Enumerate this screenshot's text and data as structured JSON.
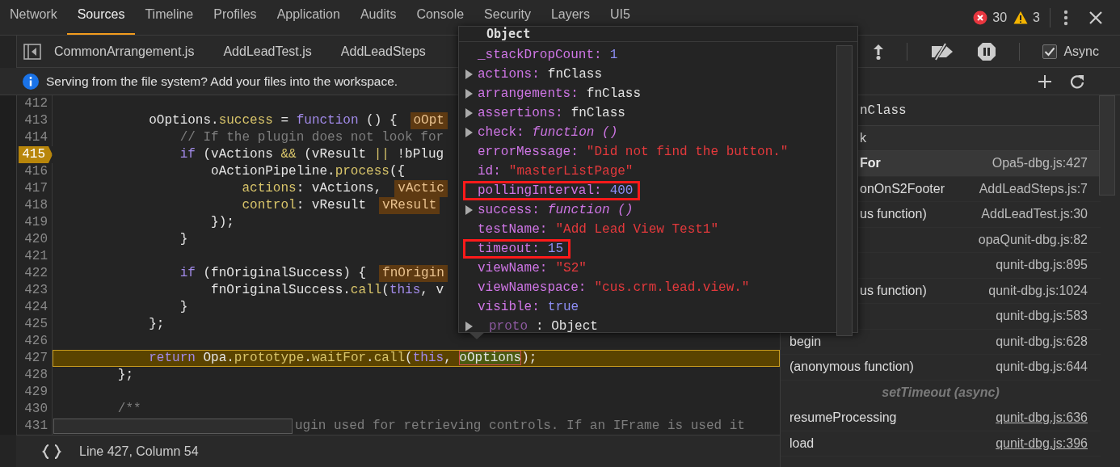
{
  "main_tabs": [
    {
      "label": "Network",
      "selected": false
    },
    {
      "label": "Sources",
      "selected": true
    },
    {
      "label": "Timeline",
      "selected": false
    },
    {
      "label": "Profiles",
      "selected": false
    },
    {
      "label": "Application",
      "selected": false
    },
    {
      "label": "Audits",
      "selected": false
    },
    {
      "label": "Console",
      "selected": false
    },
    {
      "label": "Security",
      "selected": false
    },
    {
      "label": "Layers",
      "selected": false
    },
    {
      "label": "UI5",
      "selected": false
    }
  ],
  "counts": {
    "errors": "30",
    "warnings": "3"
  },
  "editor_tabs": [
    {
      "label": "CommonArrangement.js"
    },
    {
      "label": "AddLeadTest.js"
    },
    {
      "label": "AddLeadSteps"
    }
  ],
  "debugger_toolbar": {
    "async": {
      "label": "Async",
      "checked": true
    }
  },
  "info_bar": {
    "message": "Serving from the file system? Add your files into the workspace."
  },
  "code": {
    "lines": [
      {
        "number": "412",
        "breakpoint": false,
        "current": false
      },
      {
        "number": "413",
        "breakpoint": false,
        "current": false,
        "tokens": [
          {
            "text": "            oOptions.",
            "kind": "plain"
          },
          {
            "text": "success",
            "kind": "property"
          },
          {
            "text": " = ",
            "kind": "plain"
          },
          {
            "text": "function",
            "kind": "keyword"
          },
          {
            "text": " () {",
            "kind": "plain"
          },
          {
            "text": "oOpt",
            "kind": "inline-value"
          }
        ]
      },
      {
        "number": "414",
        "breakpoint": false,
        "current": false,
        "tokens": [
          {
            "text": "                // If the plugin does not look for",
            "kind": "comment"
          }
        ]
      },
      {
        "number": "415",
        "breakpoint": true,
        "current": false,
        "tokens": [
          {
            "text": "                if",
            "kind": "keyword"
          },
          {
            "text": " (vActions ",
            "kind": "plain"
          },
          {
            "text": "&&",
            "kind": "property"
          },
          {
            "text": " (vResult ",
            "kind": "plain"
          },
          {
            "text": "||",
            "kind": "property"
          },
          {
            "text": " !bPlug",
            "kind": "plain"
          }
        ]
      },
      {
        "number": "416",
        "breakpoint": false,
        "current": false,
        "tokens": [
          {
            "text": "                    oActionPipeline.",
            "kind": "plain"
          },
          {
            "text": "process",
            "kind": "property"
          },
          {
            "text": "({",
            "kind": "plain"
          }
        ]
      },
      {
        "number": "417",
        "breakpoint": false,
        "current": false,
        "tokens": [
          {
            "text": "                        actions",
            "kind": "property"
          },
          {
            "text": ": vActions,",
            "kind": "plain"
          },
          {
            "text": "vActic",
            "kind": "inline-value"
          }
        ]
      },
      {
        "number": "418",
        "breakpoint": false,
        "current": false,
        "tokens": [
          {
            "text": "                        control",
            "kind": "property"
          },
          {
            "text": ": vResult",
            "kind": "plain"
          },
          {
            "text": "vResult",
            "kind": "inline-value"
          }
        ]
      },
      {
        "number": "419",
        "breakpoint": false,
        "current": false,
        "tokens": [
          {
            "text": "                    });",
            "kind": "plain"
          }
        ]
      },
      {
        "number": "420",
        "breakpoint": false,
        "current": false,
        "tokens": [
          {
            "text": "                }",
            "kind": "plain"
          }
        ]
      },
      {
        "number": "421",
        "breakpoint": false,
        "current": false
      },
      {
        "number": "422",
        "breakpoint": false,
        "current": false,
        "tokens": [
          {
            "text": "                if",
            "kind": "keyword"
          },
          {
            "text": " (fnOriginalSuccess) {",
            "kind": "plain"
          },
          {
            "text": "fnOrigin",
            "kind": "inline-value"
          }
        ]
      },
      {
        "number": "423",
        "breakpoint": false,
        "current": false,
        "tokens": [
          {
            "text": "                    fnOriginalSuccess.",
            "kind": "plain"
          },
          {
            "text": "call",
            "kind": "property"
          },
          {
            "text": "(",
            "kind": "plain"
          },
          {
            "text": "this",
            "kind": "keyword"
          },
          {
            "text": ", v",
            "kind": "plain"
          }
        ]
      },
      {
        "number": "424",
        "breakpoint": false,
        "current": false,
        "tokens": [
          {
            "text": "                }",
            "kind": "plain"
          }
        ]
      },
      {
        "number": "425",
        "breakpoint": false,
        "current": false,
        "tokens": [
          {
            "text": "            };",
            "kind": "plain"
          }
        ]
      },
      {
        "number": "426",
        "breakpoint": false,
        "current": false
      },
      {
        "number": "427",
        "breakpoint": false,
        "current": true,
        "tokens": [
          {
            "text": "            return",
            "kind": "keyword"
          },
          {
            "text": " Opa.",
            "kind": "plain"
          },
          {
            "text": "prototype",
            "kind": "property"
          },
          {
            "text": ".",
            "kind": "plain"
          },
          {
            "text": "waitFor",
            "kind": "property"
          },
          {
            "text": ".",
            "kind": "plain"
          },
          {
            "text": "call",
            "kind": "property"
          },
          {
            "text": "(",
            "kind": "plain"
          },
          {
            "text": "this",
            "kind": "keyword"
          },
          {
            "text": ", ",
            "kind": "plain"
          },
          {
            "text": "oOptions",
            "kind": "hover-target"
          },
          {
            "text": ");",
            "kind": "plain"
          }
        ]
      },
      {
        "number": "428",
        "breakpoint": false,
        "current": false,
        "tokens": [
          {
            "text": "        };",
            "kind": "plain"
          }
        ]
      },
      {
        "number": "429",
        "breakpoint": false,
        "current": false
      },
      {
        "number": "430",
        "breakpoint": false,
        "current": false,
        "tokens": [
          {
            "text": "        /**",
            "kind": "comment"
          }
        ]
      },
      {
        "number": "431",
        "breakpoint": false,
        "current": false,
        "tokens": [
          {
            "text": "ugin used for retrieving controls. If an IFrame is used it",
            "kind": "comment"
          }
        ]
      }
    ]
  },
  "status_bar": {
    "position": "Line 427, Column 54"
  },
  "watch": {
    "value": "nClass"
  },
  "call_stack": {
    "header": "k",
    "frames": [
      {
        "name": "For",
        "location": "Opa5-dbg.js:427",
        "selected": true,
        "underlined": false,
        "kind": "frame"
      },
      {
        "name": "onOnS2Footer",
        "location": "AddLeadSteps.js:7",
        "selected": false,
        "underlined": false,
        "kind": "frame"
      },
      {
        "name": "us function)",
        "location": "AddLeadTest.js:30",
        "selected": false,
        "underlined": false,
        "kind": "frame"
      },
      {
        "location": "opaQunit-dbg.js:82",
        "selected": false,
        "underlined": false,
        "kind": "frame"
      },
      {
        "location": "qunit-dbg.js:895",
        "selected": false,
        "underlined": false,
        "kind": "frame"
      },
      {
        "name": "us function)",
        "location": "qunit-dbg.js:1024",
        "selected": false,
        "underlined": false,
        "kind": "frame"
      },
      {
        "location": "qunit-dbg.js:583",
        "selected": false,
        "underlined": false,
        "kind": "frame"
      },
      {
        "name": "begin",
        "location": "qunit-dbg.js:628",
        "selected": false,
        "underlined": false,
        "kind": "frame"
      },
      {
        "name": "(anonymous function)",
        "location": "qunit-dbg.js:644",
        "selected": false,
        "underlined": false,
        "kind": "frame"
      },
      {
        "name": "setTimeout (async)",
        "kind": "async"
      },
      {
        "name": "resumeProcessing",
        "location": "qunit-dbg.js:636",
        "selected": false,
        "underlined": true,
        "kind": "frame"
      },
      {
        "name": "load",
        "location": "qunit-dbg.js:396",
        "selected": false,
        "underlined": true,
        "kind": "frame"
      }
    ]
  },
  "popover": {
    "title": "Object",
    "properties": [
      {
        "key": "_stackDropCount:",
        "value": "1",
        "kind": "number",
        "expandable": false,
        "highlighted": false
      },
      {
        "key": "actions:",
        "value": "fnClass",
        "kind": "object",
        "expandable": true,
        "highlighted": false
      },
      {
        "key": "arrangements:",
        "value": "fnClass",
        "kind": "object",
        "expandable": true,
        "highlighted": false
      },
      {
        "key": "assertions:",
        "value": "fnClass",
        "kind": "object",
        "expandable": true,
        "highlighted": false
      },
      {
        "key": "check:",
        "value": "function ()",
        "kind": "function",
        "expandable": true,
        "highlighted": false
      },
      {
        "key": "errorMessage:",
        "value": "\"Did not find the button.\"",
        "kind": "string",
        "expandable": false,
        "highlighted": false
      },
      {
        "key": "id:",
        "value": "\"masterListPage\"",
        "kind": "string",
        "expandable": false,
        "highlighted": false
      },
      {
        "key": "pollingInterval:",
        "value": "400",
        "kind": "number",
        "expandable": false,
        "highlighted": true
      },
      {
        "key": "success:",
        "value": "function ()",
        "kind": "function",
        "expandable": true,
        "highlighted": false
      },
      {
        "key": "testName:",
        "value": "\"Add Lead View Test1\"",
        "kind": "string",
        "expandable": false,
        "highlighted": false
      },
      {
        "key": "timeout:",
        "value": "15",
        "kind": "number",
        "expandable": false,
        "highlighted": true
      },
      {
        "key": "viewName:",
        "value": "\"S2\"",
        "kind": "string",
        "expandable": false,
        "highlighted": false
      },
      {
        "key": "viewNamespace:",
        "value": "\"cus.crm.lead.view.\"",
        "kind": "string",
        "expandable": false,
        "highlighted": false
      },
      {
        "key": "visible:",
        "value": "true",
        "kind": "boolean",
        "expandable": false,
        "highlighted": false
      },
      {
        "key": "proto",
        "value": ": Object",
        "kind": "object",
        "expandable": true,
        "highlighted": false,
        "internal": true
      }
    ]
  }
}
